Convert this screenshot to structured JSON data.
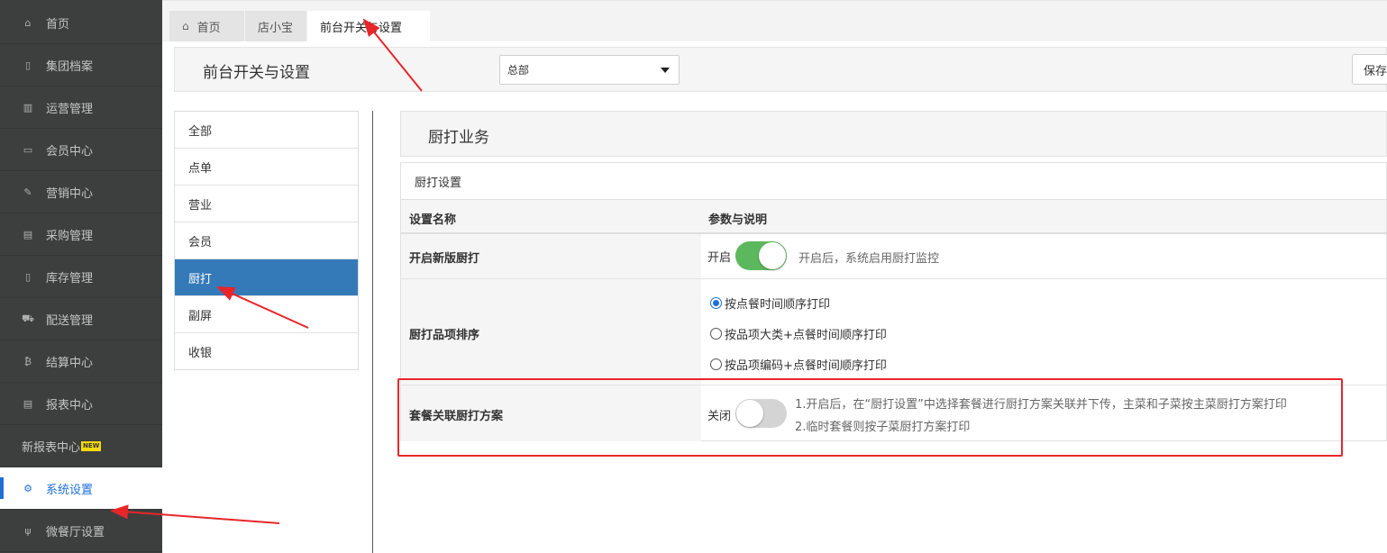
{
  "sidebar": {
    "items": [
      {
        "label": "首页",
        "icon": "home-icon",
        "glyph": "⌂"
      },
      {
        "label": "集团档案",
        "icon": "file-icon",
        "glyph": "▯"
      },
      {
        "label": "运营管理",
        "icon": "bar-chart-icon",
        "glyph": "▥"
      },
      {
        "label": "会员中心",
        "icon": "id-card-icon",
        "glyph": "▭"
      },
      {
        "label": "营销中心",
        "icon": "edit-icon",
        "glyph": "✎"
      },
      {
        "label": "采购管理",
        "icon": "book-icon",
        "glyph": "▤"
      },
      {
        "label": "库存管理",
        "icon": "inventory-icon",
        "glyph": "▯"
      },
      {
        "label": "配送管理",
        "icon": "truck-icon",
        "glyph": "⛟"
      },
      {
        "label": "结算中心",
        "icon": "bitcoin-icon",
        "glyph": "₿"
      },
      {
        "label": "报表中心",
        "icon": "report-icon",
        "glyph": "▤"
      },
      {
        "label": "新报表中心",
        "badge": "NEW"
      },
      {
        "label": "系统设置",
        "icon": "gears-icon",
        "glyph": "⚙",
        "active": true
      },
      {
        "label": "微餐厅设置",
        "icon": "cutlery-icon",
        "glyph": "ψ"
      }
    ]
  },
  "tabs": [
    {
      "label": "首页",
      "icon": "home-icon",
      "glyph": "⌂"
    },
    {
      "label": "店小宝"
    },
    {
      "label": "前台开关与设置",
      "active": true
    }
  ],
  "header": {
    "title": "前台开关与设置",
    "select_value": "总部",
    "save_label": "保存"
  },
  "categories": [
    "全部",
    "点单",
    "营业",
    "会员",
    "厨打",
    "副屏",
    "收银"
  ],
  "active_category": "厨打",
  "section_title": "厨打业务",
  "panel": {
    "heading": "厨打设置",
    "col_name": "设置名称",
    "col_param": "参数与说明",
    "rows": {
      "new_print": {
        "name": "开启新版厨打",
        "state_label": "开启",
        "toggle_on": true,
        "desc": "开启后，系统启用厨打监控"
      },
      "item_sort": {
        "name": "厨打品项排序",
        "options": [
          "按点餐时间顺序打印",
          "按品项大类+点餐时间顺序打印",
          "按品项编码+点餐时间顺序打印"
        ],
        "selected_index": 0
      },
      "combo": {
        "name": "套餐关联厨打方案",
        "state_label": "关闭",
        "toggle_on": false,
        "desc_line1": "1.开启后，在“厨打设置”中选择套餐进行厨打方案关联并下传，主菜和子菜按主菜厨打方案打印",
        "desc_line2": "2.临时套餐则按子菜厨打方案打印"
      }
    }
  },
  "colors": {
    "sidebar_bg": "#3d3f3e",
    "accent": "#1e6fd8",
    "category_active": "#357ab8",
    "toggle_on": "#5cb85c",
    "annotation": "#e8262a"
  }
}
